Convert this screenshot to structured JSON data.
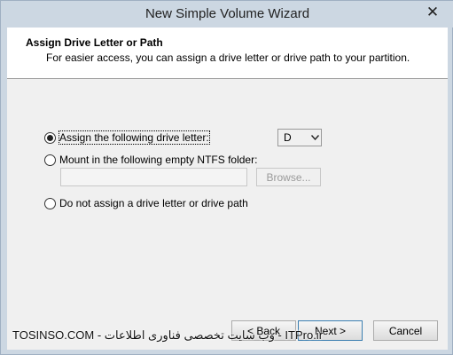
{
  "window": {
    "title": "New Simple Volume Wizard",
    "close_glyph": "✕"
  },
  "header": {
    "title": "Assign Drive Letter or Path",
    "subtitle": "For easier access, you can assign a drive letter or drive path to your partition."
  },
  "options": {
    "assign_letter": {
      "label": "Assign the following drive letter:",
      "selected": true
    },
    "mount_folder": {
      "label": "Mount in the following empty NTFS folder:",
      "selected": false
    },
    "no_assign": {
      "label": "Do not assign a drive letter or drive path",
      "selected": false
    }
  },
  "drive_select": {
    "value": "D"
  },
  "folder_input": {
    "value": "",
    "placeholder": ""
  },
  "buttons": {
    "browse": "Browse...",
    "back": "< Back",
    "next": "Next >",
    "cancel": "Cancel"
  },
  "watermark": {
    "text": "TOSINSO.COM - وب سایت تخصصی فناوری اطلاعات - ITPro.ir"
  },
  "colors": {
    "titlebar": "#ccd7e2",
    "dialog_bg": "#f0f0f0",
    "header_bg": "#ffffff",
    "primary_border": "#3c7fb1"
  }
}
